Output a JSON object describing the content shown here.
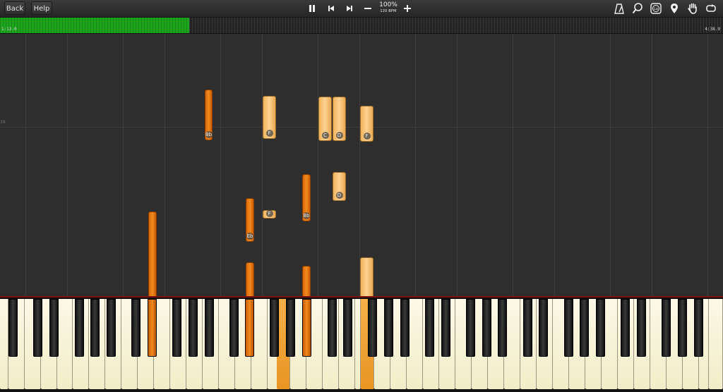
{
  "toolbar": {
    "back_label": "Back",
    "help_label": "Help",
    "speed_percent": "100%",
    "tempo": "120 BPM",
    "icons": {
      "pause": "pause-icon",
      "rewind": "skip-back-icon",
      "forward": "skip-forward-icon",
      "minus": "minus-icon",
      "plus": "plus-icon",
      "metronome": "metronome-icon",
      "zoom": "magnifier-icon",
      "note_labels": "note-label-icon",
      "marker": "location-pin-icon",
      "hands": "hand-icon",
      "loop": "loop-icon"
    }
  },
  "timeline": {
    "start_time": "1:13.0",
    "end_time": "4:38.9",
    "progress_fraction": 0.262
  },
  "roll": {
    "measure_number": "39"
  },
  "notes": [
    {
      "label": "Bb",
      "style": "dark"
    },
    {
      "label": "F",
      "style": "light"
    },
    {
      "label": "C",
      "style": "light"
    },
    {
      "label": "D",
      "style": "light"
    },
    {
      "label": "F",
      "style": "light"
    },
    {
      "label": "D",
      "style": "light"
    },
    {
      "label": "F",
      "style": "light"
    },
    {
      "label": "Eb",
      "style": "dark"
    },
    {
      "label": "Bb",
      "style": "dark"
    },
    {
      "label": "",
      "style": "dark"
    },
    {
      "label": "",
      "style": "dark"
    },
    {
      "label": "",
      "style": "dark"
    },
    {
      "label": "",
      "style": "light"
    }
  ],
  "colors": {
    "left_hand": "#f28a1e",
    "right_hand": "#ffd193",
    "progress": "#1ea51e"
  }
}
